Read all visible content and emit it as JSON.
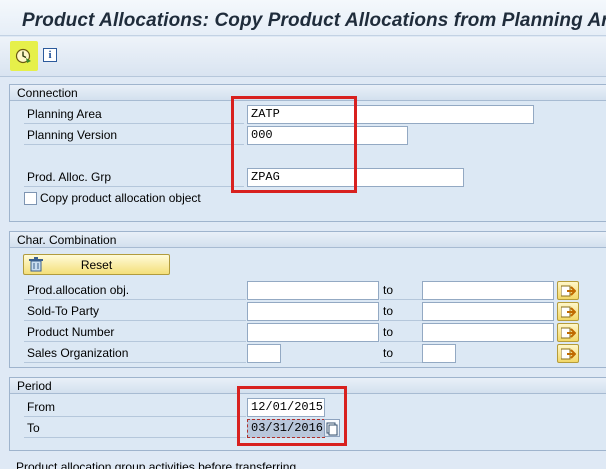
{
  "window": {
    "title": "Product Allocations: Copy Product Allocations from Planning Area"
  },
  "toolbar": {
    "execute_icon": "clock-execute-icon",
    "info_icon": "info-icon",
    "info_glyph": "i"
  },
  "connection": {
    "heading": "Connection",
    "planning_area_label": "Planning Area",
    "planning_area_value": "ZATP",
    "planning_version_label": "Planning Version",
    "planning_version_value": "000",
    "prod_alloc_grp_label": "Prod. Alloc. Grp",
    "prod_alloc_grp_value": "ZPAG",
    "copy_checkbox_label": "Copy product allocation object",
    "copy_checkbox_checked": false
  },
  "char_combination": {
    "heading": "Char. Combination",
    "reset_label": "Reset",
    "rows": [
      {
        "label": "Prod.allocation obj.",
        "from": "",
        "to_label": "to",
        "to": ""
      },
      {
        "label": "Sold-To Party",
        "from": "",
        "to_label": "to",
        "to": ""
      },
      {
        "label": "Product Number",
        "from": "",
        "to_label": "to",
        "to": ""
      },
      {
        "label": "Sales Organization",
        "from": "",
        "to_label": "to",
        "to": ""
      }
    ]
  },
  "period": {
    "heading": "Period",
    "from_label": "From",
    "from_value": "12/01/2015",
    "to_label": "To",
    "to_value": "03/31/2016"
  },
  "footer": {
    "next_group_heading": "Product allocation group activities before transferring"
  },
  "colors": {
    "highlight_red": "#d8211f",
    "execute_button_bg": "#e6f04a",
    "group_bg": "#dce8f4"
  }
}
